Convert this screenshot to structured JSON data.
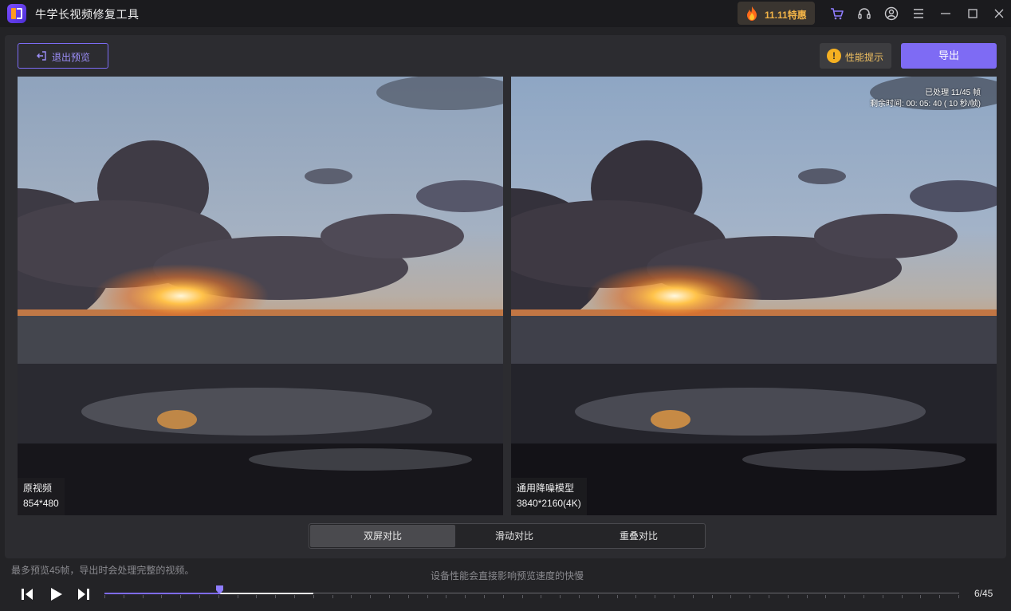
{
  "app": {
    "title": "牛学长视频修复工具"
  },
  "promo": {
    "label": "11.11特惠"
  },
  "titlebar_icons": [
    "cart-icon",
    "headset-icon",
    "user-icon",
    "menu-icon",
    "minimize-icon",
    "maximize-icon",
    "close-icon"
  ],
  "toolbar": {
    "exit_label": "退出预览",
    "perf_label": "性能提示",
    "perf_icon_glyph": "!",
    "export_label": "导出"
  },
  "left_pane": {
    "name": "原视频",
    "resolution": "854*480"
  },
  "right_pane": {
    "name": "通用降噪模型",
    "resolution": "3840*2160(4K)",
    "processed": "已处理 11/45 帧",
    "remaining": "剩余时间: 00: 05: 40 ( 10 秒/帧)"
  },
  "compare_tabs": [
    {
      "label": "双屏对比",
      "active": true
    },
    {
      "label": "滑动对比",
      "active": false
    },
    {
      "label": "重叠对比",
      "active": false
    }
  ],
  "hints": {
    "left": "最多预览45帧，导出时会处理完整的视频。",
    "center": "设备性能会直接影响预览速度的快慢"
  },
  "playback": {
    "current_frame": 6,
    "total_frames": 45,
    "frame_label": "6/45",
    "processed_frames": 11
  },
  "colors": {
    "accent": "#7e6bf4",
    "promo_text": "#f2b347",
    "warning": "#f5b021"
  }
}
